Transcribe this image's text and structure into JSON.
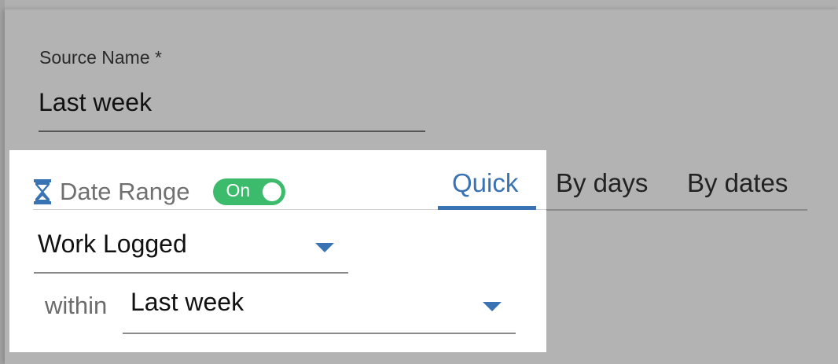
{
  "source": {
    "label": "Source Name *",
    "value": "Last week"
  },
  "date_range": {
    "icon": "hourglass-icon",
    "label": "Date Range",
    "toggle_text": "On",
    "toggle_on": true
  },
  "tabs": [
    {
      "label": "Quick",
      "active": true
    },
    {
      "label": "By days",
      "active": false
    },
    {
      "label": "By dates",
      "active": false
    }
  ],
  "field_select": {
    "value": "Work Logged"
  },
  "within": {
    "label": "within",
    "value": "Last week"
  },
  "colors": {
    "accent": "#3a73b3",
    "toggle": "#3dbb6d",
    "overlay": "#b3b3b3",
    "panel": "#ffffff"
  }
}
